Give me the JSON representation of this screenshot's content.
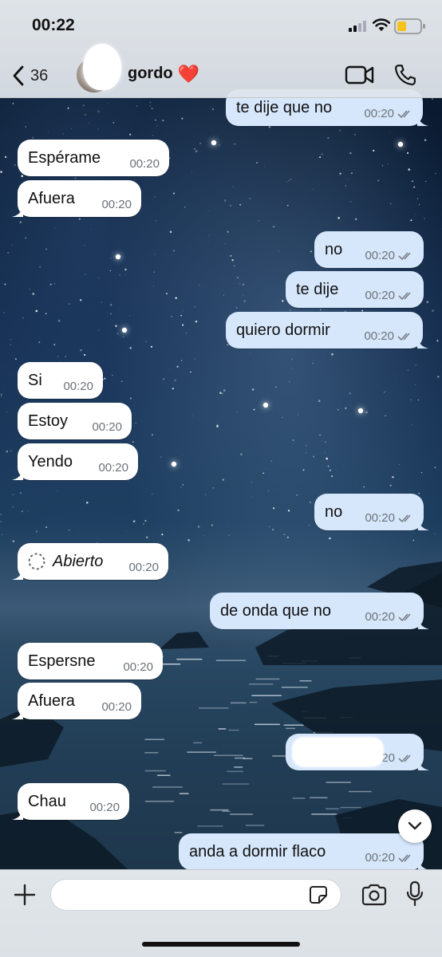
{
  "status_bar": {
    "time": "00:22"
  },
  "header": {
    "back_count": "36",
    "contact_name": "gordo",
    "contact_emoji": "❤️"
  },
  "messages": [
    {
      "dir": "out",
      "text": "te dije que no",
      "time": "00:20"
    },
    {
      "dir": "in",
      "text": "Espérame",
      "time": "00:20"
    },
    {
      "dir": "in",
      "text": "Afuera",
      "time": "00:20"
    },
    {
      "dir": "out",
      "text": "no",
      "time": "00:20"
    },
    {
      "dir": "out",
      "text": "te dije",
      "time": "00:20"
    },
    {
      "dir": "out",
      "text": "quiero dormir",
      "time": "00:20"
    },
    {
      "dir": "in",
      "text": "Si",
      "time": "00:20"
    },
    {
      "dir": "in",
      "text": "Estoy",
      "time": "00:20"
    },
    {
      "dir": "in",
      "text": "Yendo",
      "time": "00:20"
    },
    {
      "dir": "out",
      "text": "no",
      "time": "00:20"
    },
    {
      "dir": "in",
      "text": "Abierto",
      "time": "00:20",
      "view_once": true
    },
    {
      "dir": "out",
      "text": "de onda que no",
      "time": "00:20"
    },
    {
      "dir": "in",
      "text": "Espersne",
      "time": "00:20"
    },
    {
      "dir": "in",
      "text": "Afuera",
      "time": "00:20"
    },
    {
      "dir": "out",
      "text": "",
      "time": "20",
      "redacted": true
    },
    {
      "dir": "in",
      "text": "Chau",
      "time": "00:20"
    },
    {
      "dir": "out",
      "text": "anda a dormir flaco",
      "time": "00:20"
    }
  ],
  "input": {
    "placeholder": "",
    "value": ""
  }
}
